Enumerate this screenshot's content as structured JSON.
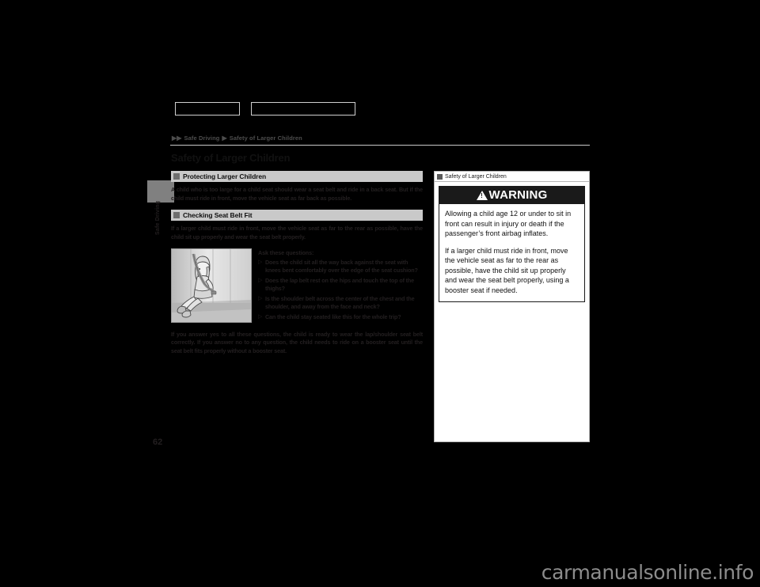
{
  "document": {
    "page_number": "62",
    "watermark": "carmanualsonline.info"
  },
  "top_boxes": [
    {
      "name": "top-box-left",
      "label": ""
    },
    {
      "name": "top-box-right",
      "label": ""
    }
  ],
  "side_tab": {
    "label": "Safe Driving"
  },
  "breadcrumb": {
    "arrow": "▶▶",
    "item1": "Safe Driving",
    "separator": "▶",
    "item2": "Safety of Larger Children"
  },
  "page_title": "Safety of Larger Children",
  "sections": [
    {
      "heading": "Protecting Larger Children",
      "paragraph": "A child who is too large for a child seat should wear a seat belt and ride in a back seat. But if the child must ride in front, move the vehicle seat as far back as possible."
    },
    {
      "heading": "Checking Seat Belt Fit",
      "paragraph": "If a larger child must ride in front, move the vehicle seat as far to the rear as possible, have the child sit up properly and wear the seat belt properly.",
      "figure_caption": "",
      "checklist_title": "Ask these questions:",
      "checklist": [
        "Does the child sit all the way back against the seat with knees bent comfortably over the edge of the seat cushion?",
        "Does the lap belt rest on the hips and touch the top of the thighs?",
        "Is the shoulder belt across the center of the chest and the shoulder, and away from the face and neck?",
        "Can the child stay seated like this for the whole trip?"
      ],
      "closing_paragraph": "If you answer yes to all these questions, the child is ready to wear the lap/shoulder seat belt correctly. If you answer no to any question, the child needs to ride on a booster seat until the seat belt fits properly without a booster seat."
    }
  ],
  "side_panel": {
    "header_label": "Safety of Larger Children",
    "warning": {
      "title": "WARNING",
      "paragraphs": [
        "Allowing a child age 12 or under to sit in front can result in injury or death if the passenger’s front airbag inflates.",
        "If a larger child must ride in front, move the vehicle seat as far to the rear as possible, have the child sit up properly and wear the seat belt properly, using a booster seat if needed."
      ]
    }
  }
}
